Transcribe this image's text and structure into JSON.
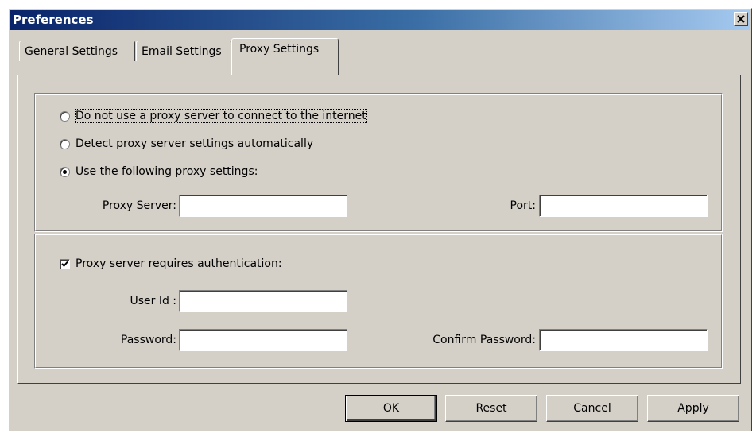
{
  "window": {
    "title": "Preferences",
    "close_icon": "close-icon"
  },
  "tabs": [
    {
      "label": "General Settings",
      "selected": false
    },
    {
      "label": "Email Settings",
      "selected": false
    },
    {
      "label": "Proxy Settings",
      "selected": true
    }
  ],
  "proxy": {
    "options": [
      {
        "label": "Do not use a proxy server to connect to the internet",
        "checked": false
      },
      {
        "label": "Detect proxy server settings automatically",
        "checked": false
      },
      {
        "label": "Use the following proxy settings:",
        "checked": true
      }
    ],
    "server_label": "Proxy Server:",
    "server_value": "",
    "port_label": "Port:",
    "port_value": ""
  },
  "auth": {
    "checkbox_label": "Proxy server requires authentication:",
    "checked": true,
    "user_label": "User Id :",
    "user_value": "",
    "password_label": "Password:",
    "password_value": "",
    "confirm_label": "Confirm Password:",
    "confirm_value": ""
  },
  "buttons": {
    "ok": "OK",
    "reset": "Reset",
    "cancel": "Cancel",
    "apply": "Apply"
  }
}
